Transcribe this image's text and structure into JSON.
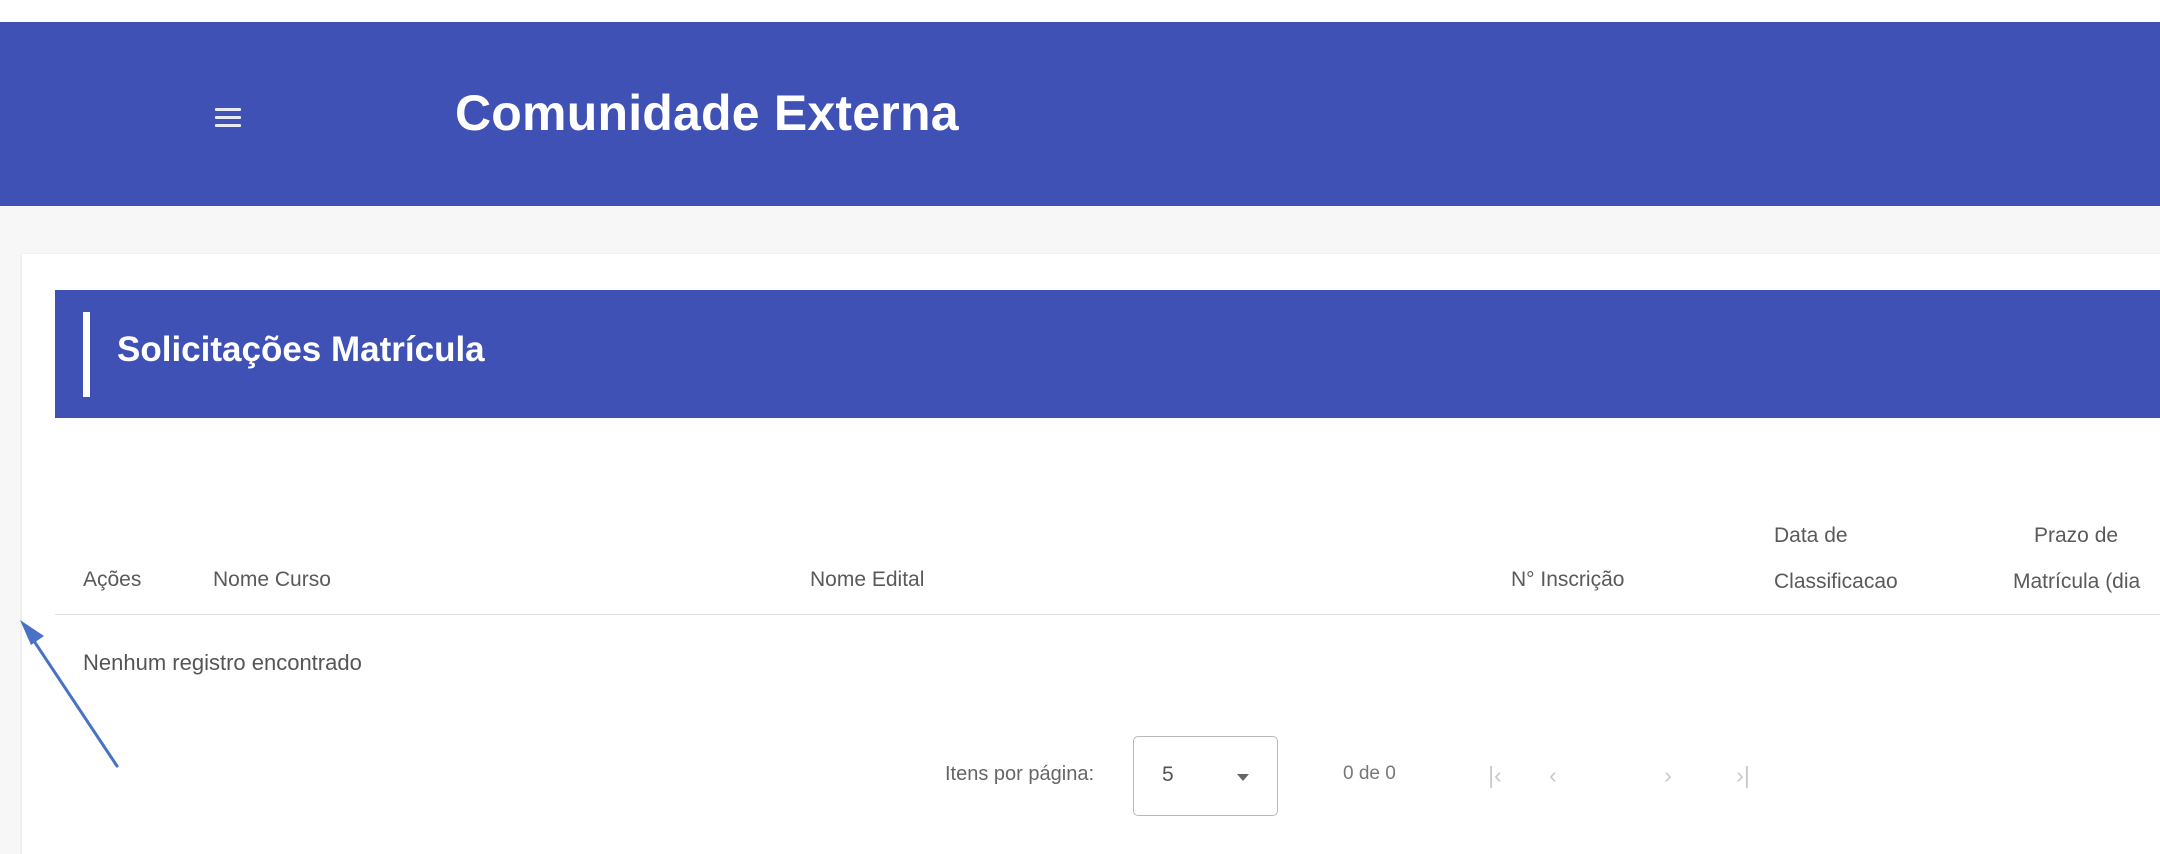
{
  "toolbar": {
    "title": "Comunidade Externa",
    "menu_icon": "menu-icon",
    "background_color": "#3f51b5"
  },
  "section": {
    "title": "Solicitações Matrícula"
  },
  "table": {
    "columns": [
      {
        "line1": "Ações",
        "line2": ""
      },
      {
        "line1": "Nome Curso",
        "line2": ""
      },
      {
        "line1": "Nome Edital",
        "line2": ""
      },
      {
        "line1": "N° Inscrição",
        "line2": ""
      },
      {
        "line1": "Data de",
        "line2": "Classificacao"
      },
      {
        "line1": "Prazo de",
        "line2": "Matrícula (dia"
      }
    ],
    "empty_message": "Nenhum registro encontrado"
  },
  "paginator": {
    "items_per_page_label": "Itens por página:",
    "page_size": "5",
    "range_label": "0 de 0",
    "first_icon": "first-page-icon",
    "prev_icon": "chevron-left-icon",
    "next_icon": "chevron-right-icon",
    "last_icon": "last-page-icon"
  },
  "annotation": {
    "icon": "arrow-annotation-icon",
    "color": "#4a72c4"
  }
}
